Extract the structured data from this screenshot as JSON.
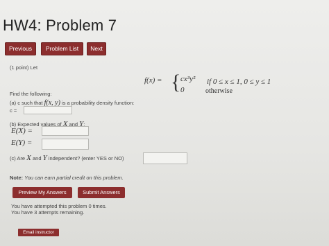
{
  "page": {
    "title": "HW4: Problem 7"
  },
  "nav": {
    "previous": "Previous",
    "problem_list": "Problem List",
    "next": "Next"
  },
  "problem": {
    "points": "(1 point) Let",
    "function_label": "f(x) =",
    "case1_expr": "cx³y⁵",
    "case1_cond": "if   0 ≤ x ≤ 1,  0 ≤ y ≤ 1",
    "case2_expr": "0",
    "case2_cond": "otherwise",
    "find_following": "Find the following:",
    "part_a_pre": "(a) c such that ",
    "part_a_math": "f(x, y)",
    "part_a_post": " is a probability density function:",
    "c_label": "c =",
    "c_value": "",
    "part_b_pre": "(b) Expected values of ",
    "part_b_math": "X",
    "part_b_and": " and ",
    "part_b_math2": "Y",
    "part_b_colon": ":",
    "ex_label": "E(X) =",
    "ex_value": "",
    "ey_label": "E(Y) =",
    "ey_value": "",
    "part_c_pre": "(c) Are ",
    "part_c_x": "X",
    "part_c_and": " and ",
    "part_c_y": "Y",
    "part_c_post": " independent? (enter YES or NO)",
    "indep_value": ""
  },
  "note": {
    "bold": "Note:",
    "text": " You can earn partial credit on this problem."
  },
  "actions": {
    "preview": "Preview My Answers",
    "submit": "Submit Answers"
  },
  "status": {
    "attempted": "You have attempted this problem 0 times.",
    "remaining": "You have 3 attempts remaining."
  },
  "footer": {
    "email": "Email instructor"
  },
  "colors": {
    "button": "#8c2e2e",
    "background": "#e9e9e6"
  }
}
